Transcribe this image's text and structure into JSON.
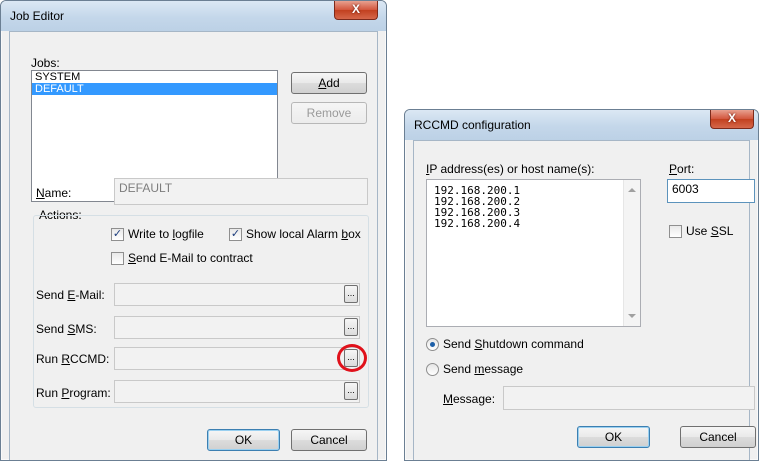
{
  "job_editor": {
    "title": "Job Editor",
    "close_glyph": "X",
    "jobs_label": "Jobs:",
    "jobs": [
      "SYSTEM",
      "DEFAULT"
    ],
    "selected_job": "DEFAULT",
    "add_button": {
      "pre": "",
      "ul": "A",
      "post": "dd"
    },
    "remove_button": "Remove",
    "name_label": {
      "pre": "",
      "ul": "N",
      "post": "ame:"
    },
    "name_value": "DEFAULT",
    "actions_label": "Actions:",
    "write_logfile": {
      "pre": "Write to ",
      "ul": "l",
      "post": "ogfile",
      "checked_glyph": "✓"
    },
    "show_alarm": {
      "pre": "Show local Alarm ",
      "ul": "b",
      "post": "ox",
      "checked_glyph": "✓"
    },
    "send_email_contract": {
      "pre": "",
      "ul": "S",
      "post": "end E-Mail to contract"
    },
    "send_email": {
      "pre": "Send ",
      "ul": "E",
      "post": "-Mail:"
    },
    "send_sms": {
      "pre": "Send ",
      "ul": "S",
      "post": "MS:"
    },
    "run_rccmd": {
      "pre": "Run ",
      "ul": "R",
      "post": "CCMD:"
    },
    "run_program": {
      "pre": "Run ",
      "ul": "P",
      "post": "rogram:"
    },
    "ellipsis": "...",
    "ok_button": "OK",
    "cancel_button": "Cancel"
  },
  "rccmd_config": {
    "title": "RCCMD configuration",
    "close_glyph": "X",
    "ip_label": {
      "pre": "",
      "ul": "I",
      "post": "P address(es) or host name(s):"
    },
    "port_label": {
      "pre": "",
      "ul": "P",
      "post": "ort:"
    },
    "ip_addresses": [
      "192.168.200.1",
      "192.168.200.2",
      "192.168.200.3",
      "192.168.200.4"
    ],
    "port_value": "6003",
    "use_ssl": {
      "pre": "Use ",
      "ul": "S",
      "post": "SL"
    },
    "send_shutdown": {
      "pre": "Send ",
      "ul": "S",
      "post": "hutdown command"
    },
    "send_message": {
      "pre": "Send ",
      "ul": "m",
      "post": "essage"
    },
    "message_label": {
      "pre": "",
      "ul": "M",
      "post": "essage:"
    },
    "message_value": "",
    "ok_button": "OK",
    "cancel_button": "Cancel"
  },
  "annotation": {
    "color": "#e0111b"
  }
}
